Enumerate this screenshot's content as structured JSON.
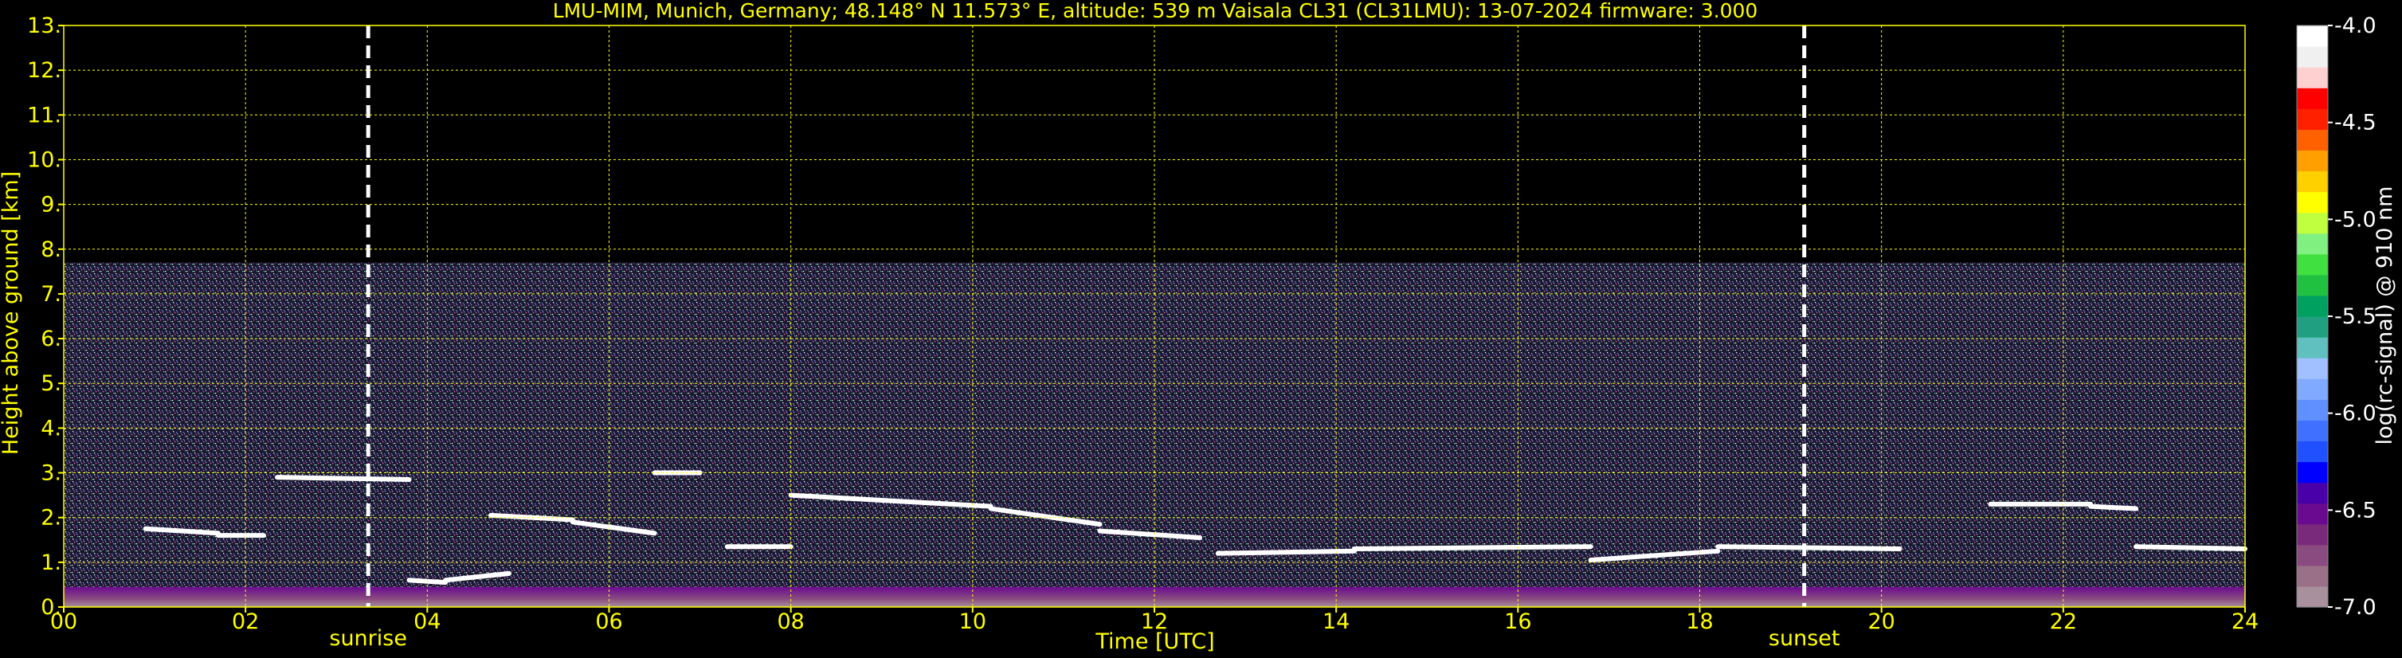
{
  "chart_data": {
    "type": "heatmap",
    "title": "LMU-MIM, Munich, Germany; 48.148° N 11.573° E, altitude: 539 m    Vaisala CL31 (CL31LMU): 13-07-2024    firmware: 3.000",
    "xlabel": "Time [UTC]",
    "ylabel": "Height above ground [km]",
    "xlim": [
      0,
      24
    ],
    "ylim": [
      0,
      13
    ],
    "x_ticks": [
      "00",
      "02",
      "04",
      "06",
      "08",
      "10",
      "12",
      "14",
      "16",
      "18",
      "20",
      "22",
      "24"
    ],
    "x_tick_values": [
      0,
      2,
      4,
      6,
      8,
      10,
      12,
      14,
      16,
      18,
      20,
      22,
      24
    ],
    "y_ticks": [
      "0.",
      "1.",
      "2.",
      "3.",
      "4.",
      "5.",
      "6.",
      "7.",
      "8.",
      "9.",
      "10.",
      "11.",
      "12.",
      "13."
    ],
    "y_tick_values": [
      0,
      1,
      2,
      3,
      4,
      5,
      6,
      7,
      8,
      9,
      10,
      11,
      12,
      13
    ],
    "grid": true,
    "events": [
      {
        "label": "sunrise",
        "time": 3.35
      },
      {
        "label": "sunset",
        "time": 19.15
      }
    ],
    "signal_top_km": 7.7,
    "cloud_layers": [
      {
        "t": [
          0.9,
          1.7
        ],
        "h": [
          1.75,
          1.65
        ]
      },
      {
        "t": [
          1.7,
          2.2
        ],
        "h": [
          1.6,
          1.6
        ]
      },
      {
        "t": [
          2.35,
          3.8
        ],
        "h": [
          2.9,
          2.85
        ]
      },
      {
        "t": [
          3.8,
          4.2
        ],
        "h": [
          0.6,
          0.55
        ]
      },
      {
        "t": [
          4.2,
          4.9
        ],
        "h": [
          0.6,
          0.75
        ]
      },
      {
        "t": [
          4.7,
          5.6
        ],
        "h": [
          2.05,
          1.95
        ]
      },
      {
        "t": [
          5.6,
          6.5
        ],
        "h": [
          1.9,
          1.65
        ]
      },
      {
        "t": [
          6.5,
          7.0
        ],
        "h": [
          3.0,
          3.0
        ]
      },
      {
        "t": [
          7.3,
          8.0
        ],
        "h": [
          1.35,
          1.35
        ]
      },
      {
        "t": [
          8.0,
          10.2
        ],
        "h": [
          2.5,
          2.25
        ]
      },
      {
        "t": [
          10.2,
          11.4
        ],
        "h": [
          2.2,
          1.85
        ]
      },
      {
        "t": [
          11.4,
          12.5
        ],
        "h": [
          1.7,
          1.55
        ]
      },
      {
        "t": [
          12.7,
          14.2
        ],
        "h": [
          1.2,
          1.25
        ]
      },
      {
        "t": [
          14.2,
          16.8
        ],
        "h": [
          1.3,
          1.35
        ]
      },
      {
        "t": [
          16.8,
          18.2
        ],
        "h": [
          1.05,
          1.25
        ]
      },
      {
        "t": [
          18.2,
          20.2
        ],
        "h": [
          1.35,
          1.3
        ]
      },
      {
        "t": [
          21.2,
          22.3
        ],
        "h": [
          2.3,
          2.3
        ]
      },
      {
        "t": [
          22.3,
          22.8
        ],
        "h": [
          2.25,
          2.2
        ]
      },
      {
        "t": [
          22.8,
          24.0
        ],
        "h": [
          1.35,
          1.3
        ]
      }
    ],
    "aerosol_layer_top_km": 0.45,
    "colorbar": {
      "label": "log(rc-signal) @ 910 nm",
      "range": [
        -7.0,
        -4.0
      ],
      "ticks": [
        "-4.0",
        "-4.5",
        "-5.0",
        "-5.5",
        "-6.0",
        "-6.5",
        "-7.0"
      ],
      "tick_values": [
        -4.0,
        -4.5,
        -5.0,
        -5.5,
        -6.0,
        -6.5,
        -7.0
      ],
      "colors_bottom_to_top": [
        "#a8909c",
        "#9a7088",
        "#8a4c80",
        "#7a2a7a",
        "#6a0a90",
        "#4a00a8",
        "#0000ff",
        "#2050ff",
        "#4070ff",
        "#6090ff",
        "#80aaff",
        "#a0c0ff",
        "#60c0c0",
        "#20a080",
        "#00a060",
        "#20c040",
        "#40e040",
        "#80f080",
        "#c0ff40",
        "#ffff00",
        "#ffd000",
        "#ffa000",
        "#ff6000",
        "#ff2000",
        "#ff0000",
        "#ffd0d0",
        "#f0f0f0",
        "#ffffff"
      ]
    },
    "axis_color": "#ffff00",
    "background_color": "#000000"
  }
}
